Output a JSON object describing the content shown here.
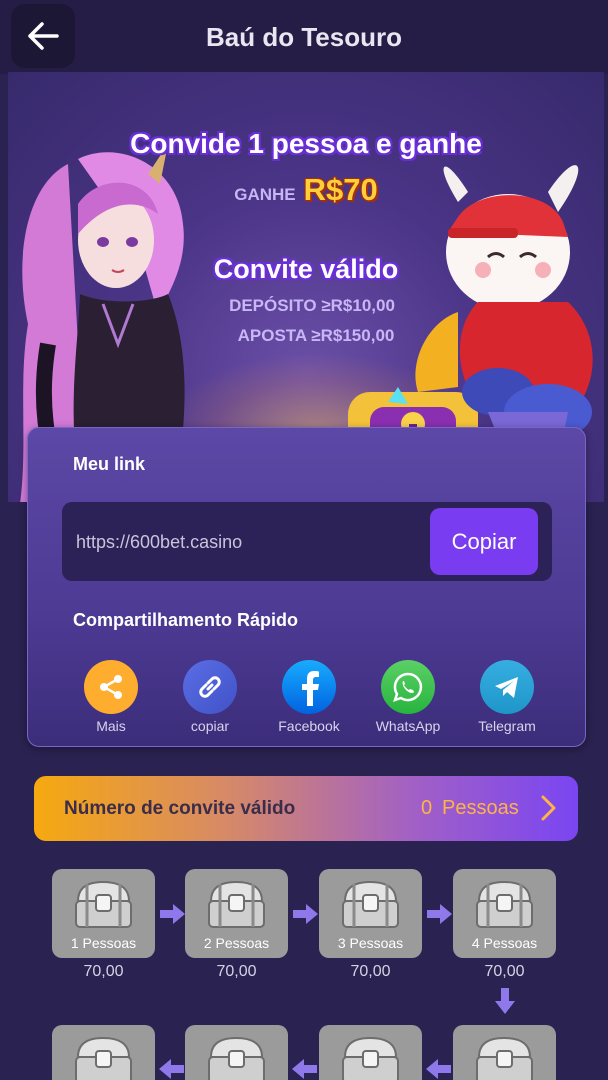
{
  "header": {
    "title": "Baú do Tesouro",
    "back_icon": "arrow-left-icon"
  },
  "banner": {
    "headline": "Convide 1 pessoa e ganhe",
    "earn_label": "GANHE",
    "earn_amount": "R$70",
    "valid_title": "Convite válido",
    "deposit_req": "DEPÓSITO ≥R$10,00",
    "bet_req": "APOSTA ≥R$150,00"
  },
  "link_card": {
    "title": "Meu link",
    "link": "https://600bet.casino",
    "copy_label": "Copiar",
    "share_title": "Compartilhamento Rápido",
    "share": [
      {
        "label": "Mais",
        "icon": "share-icon",
        "color": "#ffad2e"
      },
      {
        "label": "copiar",
        "icon": "link-icon",
        "color": "#4d5fd8"
      },
      {
        "label": "Facebook",
        "icon": "facebook-icon",
        "color": "#1877f2"
      },
      {
        "label": "WhatsApp",
        "icon": "whatsapp-icon",
        "color": "#2ec84a"
      },
      {
        "label": "Telegram",
        "icon": "telegram-icon",
        "color": "#2aa3df"
      }
    ]
  },
  "invite_bar": {
    "label": "Número de convite válido",
    "count": "0",
    "unit": "Pessoas"
  },
  "chests": [
    {
      "label": "1 Pessoas",
      "value": "70,00"
    },
    {
      "label": "2 Pessoas",
      "value": "70,00"
    },
    {
      "label": "3 Pessoas",
      "value": "70,00"
    },
    {
      "label": "4 Pessoas",
      "value": "70,00"
    }
  ]
}
